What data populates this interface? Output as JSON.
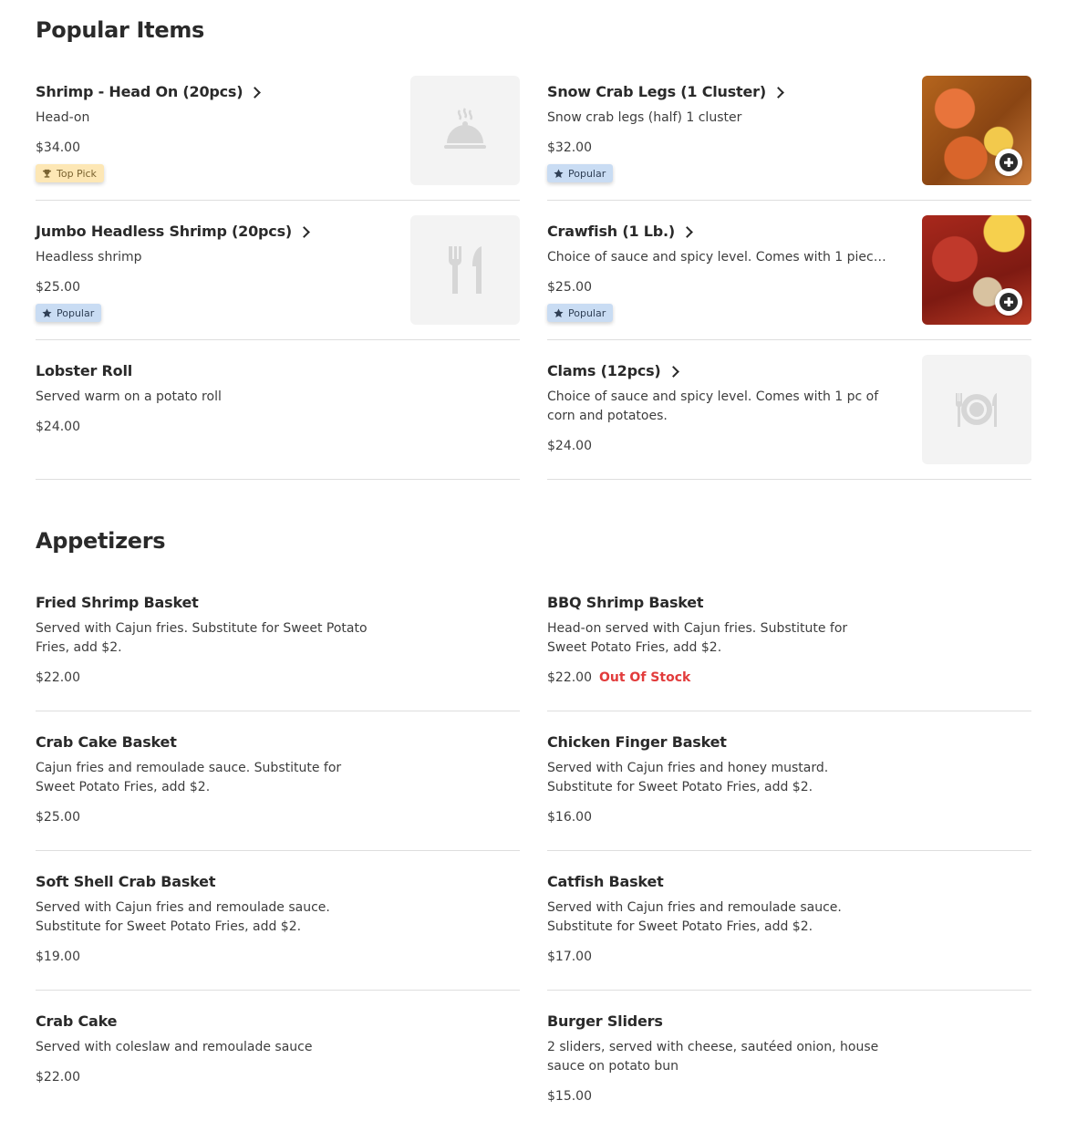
{
  "popular": {
    "title": "Popular Items",
    "items": [
      {
        "name": "Shrimp - Head On (20pcs)",
        "desc": "Head-on",
        "price": "$34.00",
        "badge": "Top Pick",
        "image": "dish-placeholder-icon"
      },
      {
        "name": "Snow Crab Legs (1 Cluster)",
        "desc": "Snow crab legs (half) 1 cluster",
        "price": "$32.00",
        "badge": "Popular",
        "image": "crab-photo"
      },
      {
        "name": "Jumbo Headless Shrimp (20pcs)",
        "desc": "Headless shrimp",
        "price": "$25.00",
        "badge": "Popular",
        "image": "utensils-placeholder-icon"
      },
      {
        "name": "Crawfish (1 Lb.)",
        "desc": "Choice of sauce and spicy level. Comes with 1 piece...",
        "price": "$25.00",
        "badge": "Popular",
        "image": "crawfish-photo"
      },
      {
        "name": "Lobster Roll",
        "desc": "Served warm on a potato roll",
        "price": "$24.00"
      },
      {
        "name": "Clams (12pcs)",
        "desc": "Choice of sauce and spicy level. Comes with 1 pc of corn and potatoes.",
        "price": "$24.00",
        "image": "plate-placeholder-icon"
      }
    ]
  },
  "appetizers": {
    "title": "Appetizers",
    "items": [
      {
        "name": "Fried Shrimp Basket",
        "desc": "Served with Cajun fries. Substitute for Sweet Potato Fries, add $2.",
        "price": "$22.00"
      },
      {
        "name": "BBQ Shrimp Basket",
        "desc": "Head-on served with Cajun fries. Substitute for Sweet Potato Fries, add $2.",
        "price": "$22.00",
        "status": "Out Of Stock"
      },
      {
        "name": "Crab Cake Basket",
        "desc": "Cajun fries and remoulade sauce. Substitute for Sweet Potato Fries, add $2.",
        "price": "$25.00"
      },
      {
        "name": "Chicken Finger Basket",
        "desc": "Served with Cajun fries and honey mustard. Substitute for Sweet Potato Fries, add $2.",
        "price": "$16.00"
      },
      {
        "name": "Soft Shell Crab Basket",
        "desc": "Served with Cajun fries and remoulade sauce. Substitute for Sweet Potato Fries, add $2.",
        "price": "$19.00"
      },
      {
        "name": "Catfish Basket",
        "desc": "Served with Cajun fries and remoulade sauce. Substitute for Sweet Potato Fries, add $2.",
        "price": "$17.00"
      },
      {
        "name": "Crab Cake",
        "desc": "Served with coleslaw and remoulade sauce",
        "price": "$22.00"
      },
      {
        "name": "Burger Sliders",
        "desc": "2 sliders, served with cheese, sautéed onion, house sauce on potato bun",
        "price": "$15.00"
      }
    ]
  },
  "colors": {
    "top_pick_badge": "#fde7b5",
    "popular_badge": "#c9dcf3",
    "out_of_stock": "#e23b3b",
    "divider": "#dedede"
  }
}
